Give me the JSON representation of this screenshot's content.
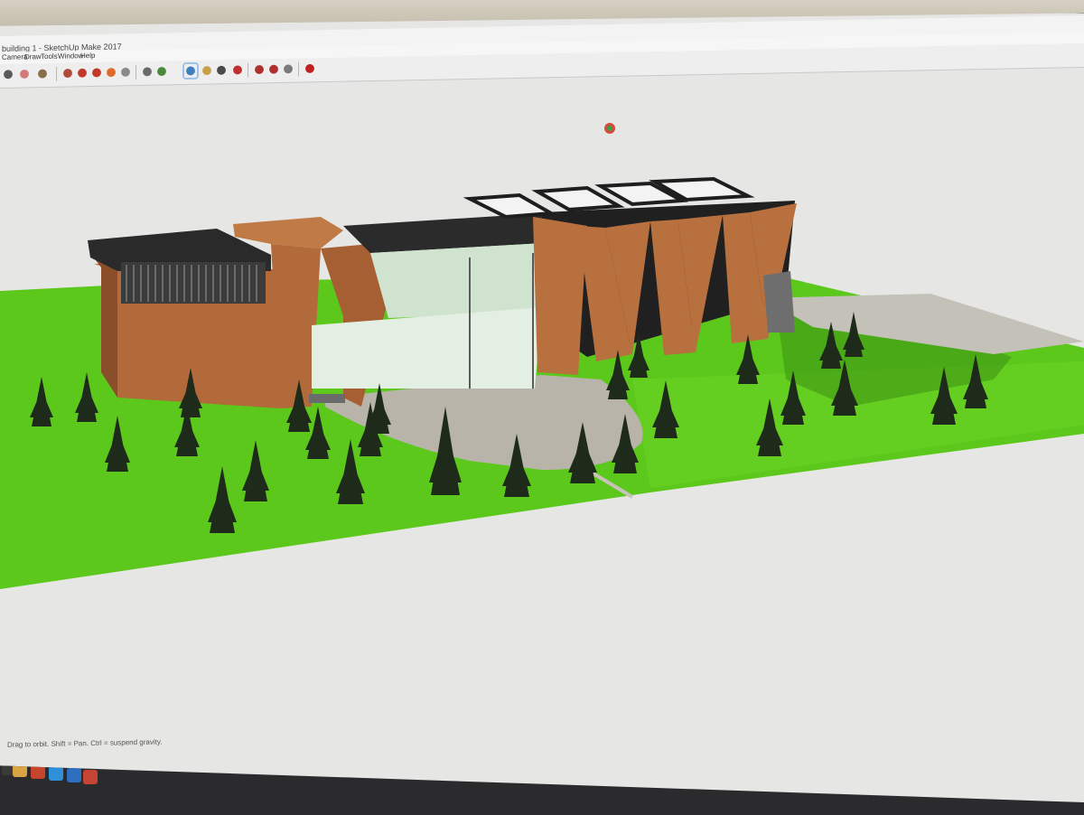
{
  "window": {
    "title": "building 1 - SketchUp Make 2017"
  },
  "menu": {
    "items": [
      "Camera",
      "Draw",
      "Tools",
      "Window",
      "Help"
    ]
  },
  "toolbar": {
    "tools": [
      {
        "icon": "select-arrow-icon",
        "color": "#5a5a5a"
      },
      {
        "icon": "eraser-icon",
        "color": "#d17a7a"
      },
      {
        "icon": "paint-bucket-icon",
        "color": "#8a6d4a"
      },
      {
        "icon": "push-pull-icon",
        "color": "#b04a3a"
      },
      {
        "icon": "move-icon",
        "color": "#c0392b"
      },
      {
        "icon": "rotate-icon",
        "color": "#c0392b"
      },
      {
        "icon": "offset-icon",
        "color": "#e06a2a"
      },
      {
        "icon": "tape-measure-icon",
        "color": "#8a8a8a"
      },
      {
        "icon": "text-icon",
        "color": "#6a6a6a"
      },
      {
        "icon": "axes-icon",
        "color": "#4a8a3a"
      },
      {
        "icon": "orbit-icon",
        "color": "#3f7fc0"
      },
      {
        "icon": "pan-icon",
        "color": "#c8a04a"
      },
      {
        "icon": "zoom-icon",
        "color": "#4a4a4a"
      },
      {
        "icon": "zoom-extents-icon",
        "color": "#c03030"
      },
      {
        "icon": "warehouse-icon",
        "color": "#b03030"
      },
      {
        "icon": "extension-warehouse-icon",
        "color": "#b03030"
      },
      {
        "icon": "layout-icon",
        "color": "#7a7a7a"
      },
      {
        "icon": "extension-icon",
        "color": "#c02020"
      }
    ]
  },
  "status": {
    "hint": "Drag to orbit. Shift = Pan. Ctrl = suspend gravity."
  },
  "taskbar": {
    "apps": [
      {
        "icon": "windows-start-icon",
        "color": "#3a3a3a"
      },
      {
        "icon": "chrome-icon",
        "color": "#d9a441"
      },
      {
        "icon": "powerpoint-icon",
        "color": "#c6452d"
      },
      {
        "icon": "edge-icon",
        "color": "#2f8fd8"
      },
      {
        "icon": "internet-explorer-icon",
        "color": "#2f6fc0"
      },
      {
        "icon": "sketchup-icon",
        "color": "#c64434"
      }
    ]
  },
  "colors": {
    "lawn": "#5cc81c",
    "cladding": "#b36a3b",
    "sky": "#e6e6e4",
    "tree": "#1e2a1a"
  }
}
